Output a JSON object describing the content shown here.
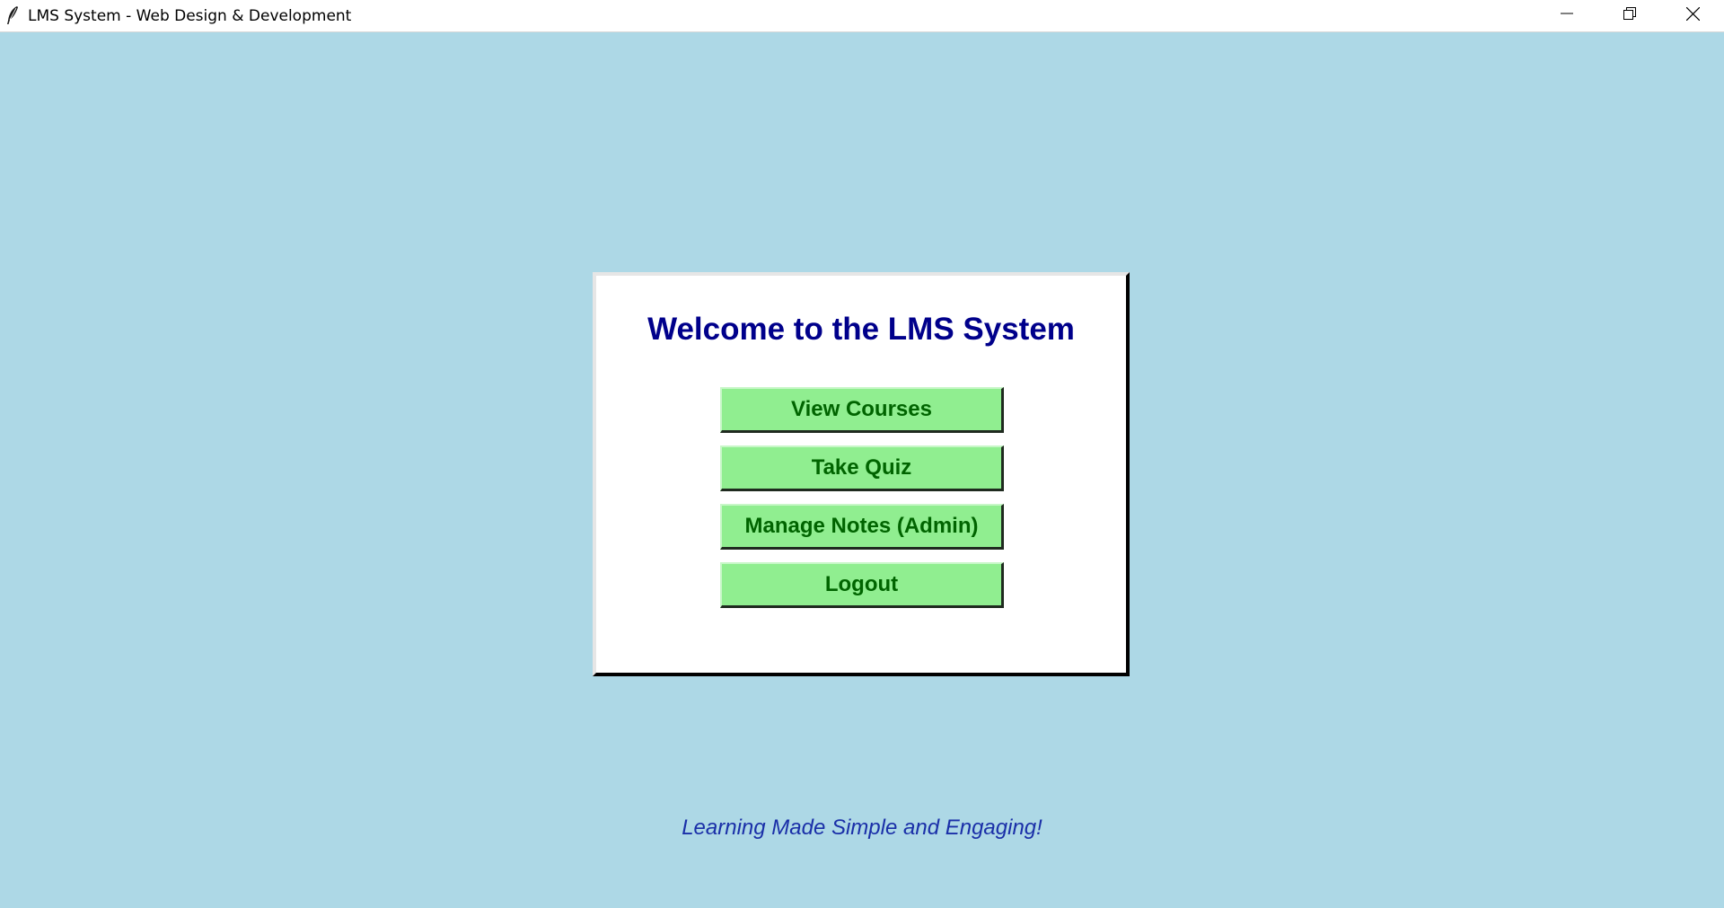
{
  "window": {
    "title": "LMS System - Web Design & Development",
    "icon": "feather-icon",
    "controls": [
      "minimize-icon",
      "restore-icon",
      "close-icon"
    ]
  },
  "panel": {
    "title": "Welcome to the LMS System",
    "buttons": [
      {
        "label": "View Courses"
      },
      {
        "label": "Take Quiz"
      },
      {
        "label": "Manage Notes (Admin)"
      },
      {
        "label": "Logout"
      }
    ]
  },
  "footer": {
    "tagline": "Learning Made Simple and Engaging!"
  },
  "colors": {
    "background": "#add8e6",
    "title_text": "#00008b",
    "button_bg": "#90ee90",
    "button_text": "#006400",
    "tagline_text": "#1a2fa8"
  }
}
